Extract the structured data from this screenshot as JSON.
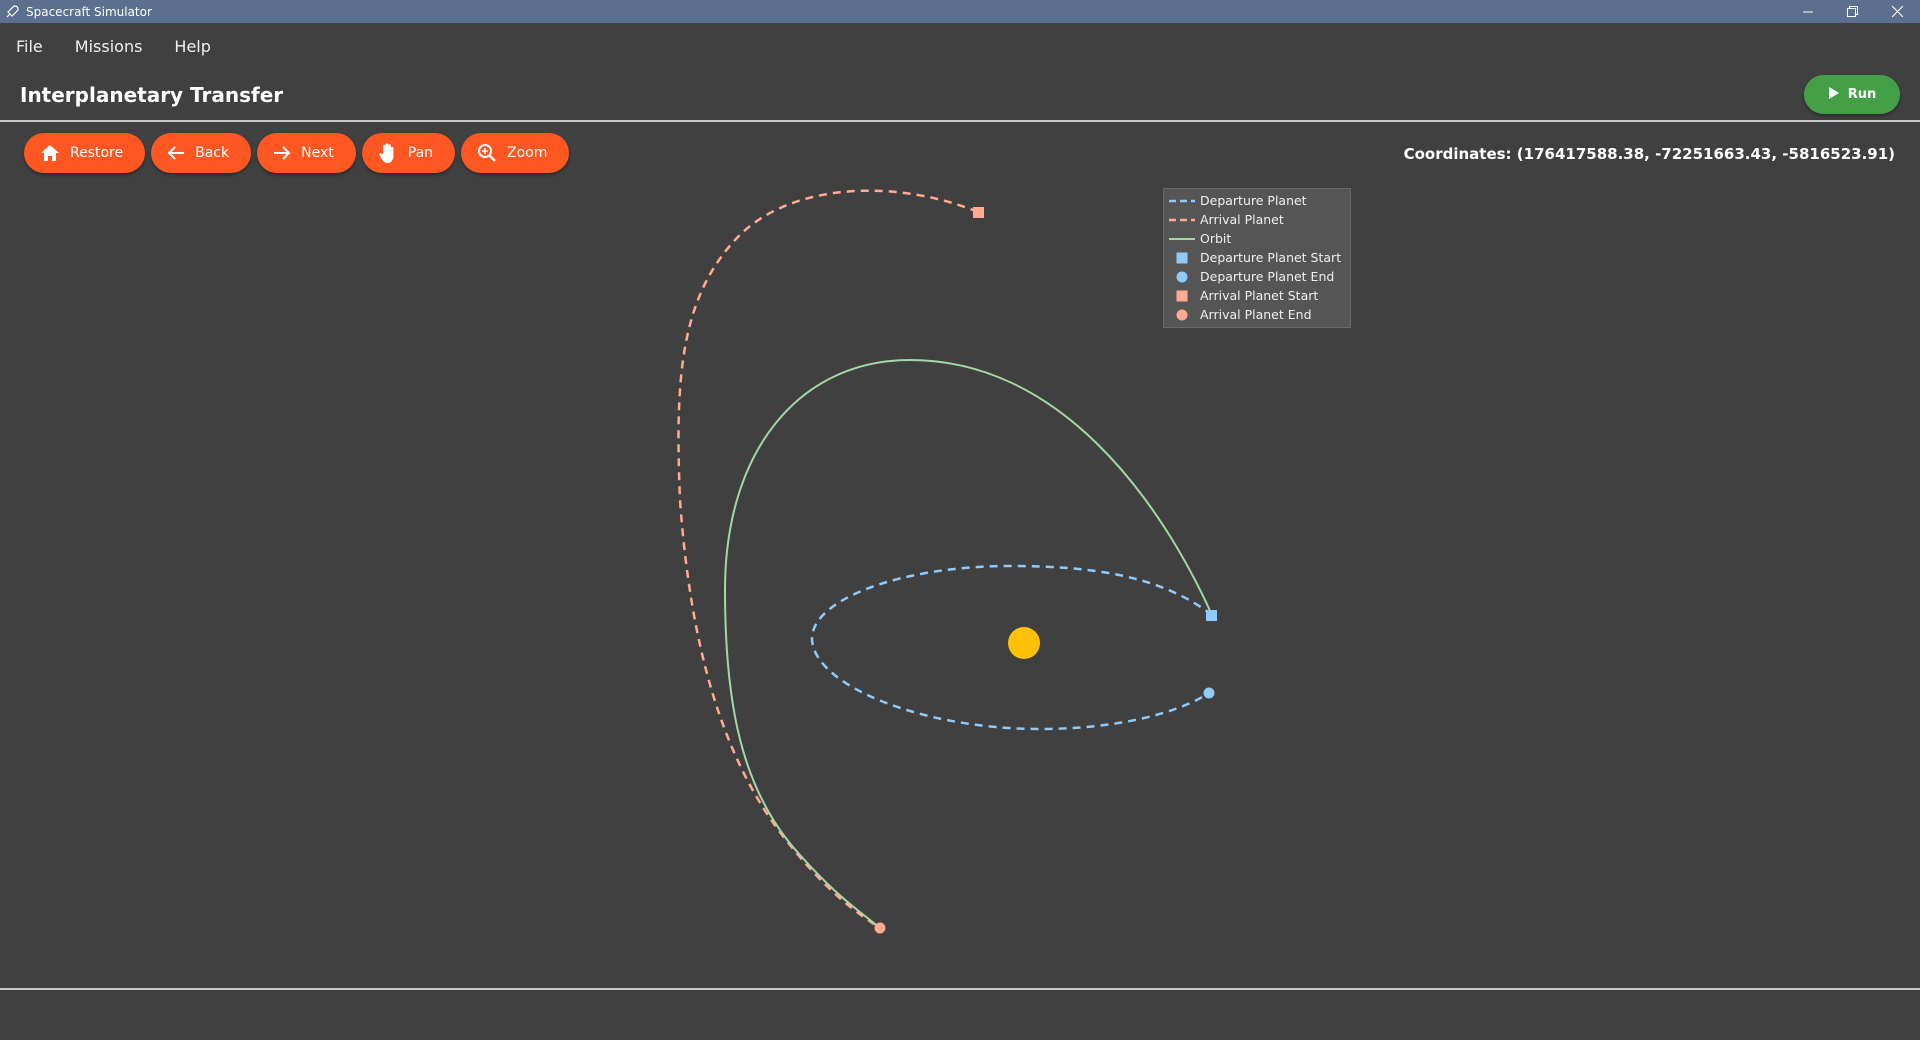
{
  "window": {
    "title": "Spacecraft Simulator",
    "icon": "rocket-icon",
    "controls": [
      "minimize-icon",
      "restore-icon",
      "close-icon"
    ]
  },
  "menu": {
    "items": [
      "File",
      "Missions",
      "Help"
    ]
  },
  "header": {
    "title": "Interplanetary Transfer",
    "run_label": "Run",
    "run_icon": "play-icon",
    "run_color": "#43a047"
  },
  "toolbar": {
    "color": "#ff5722",
    "buttons": [
      {
        "label": "Restore",
        "icon": "home-icon"
      },
      {
        "label": "Back",
        "icon": "arrow-left-icon"
      },
      {
        "label": "Next",
        "icon": "arrow-right-icon"
      },
      {
        "label": "Pan",
        "icon": "hand-icon"
      },
      {
        "label": "Zoom",
        "icon": "magnifier-icon"
      }
    ]
  },
  "coordinates": "Coordinates: (176417588.38, -72251663.43, -5816523.91)",
  "legend": {
    "entries": [
      {
        "label": "Departure Planet",
        "symbol": "dashed-line",
        "color": "#90caf9"
      },
      {
        "label": "Arrival Planet",
        "symbol": "dashed-line",
        "color": "#ffab91"
      },
      {
        "label": "Orbit",
        "symbol": "solid-line",
        "color": "#a5d6a7"
      },
      {
        "label": "Departure Planet Start",
        "symbol": "square",
        "color": "#90caf9"
      },
      {
        "label": "Departure Planet End",
        "symbol": "circle",
        "color": "#90caf9"
      },
      {
        "label": "Arrival Planet Start",
        "symbol": "square",
        "color": "#ffab91"
      },
      {
        "label": "Arrival Planet End",
        "symbol": "circle",
        "color": "#ffab91"
      }
    ]
  },
  "colors": {
    "sun": "#ffc107",
    "background": "#404040"
  }
}
